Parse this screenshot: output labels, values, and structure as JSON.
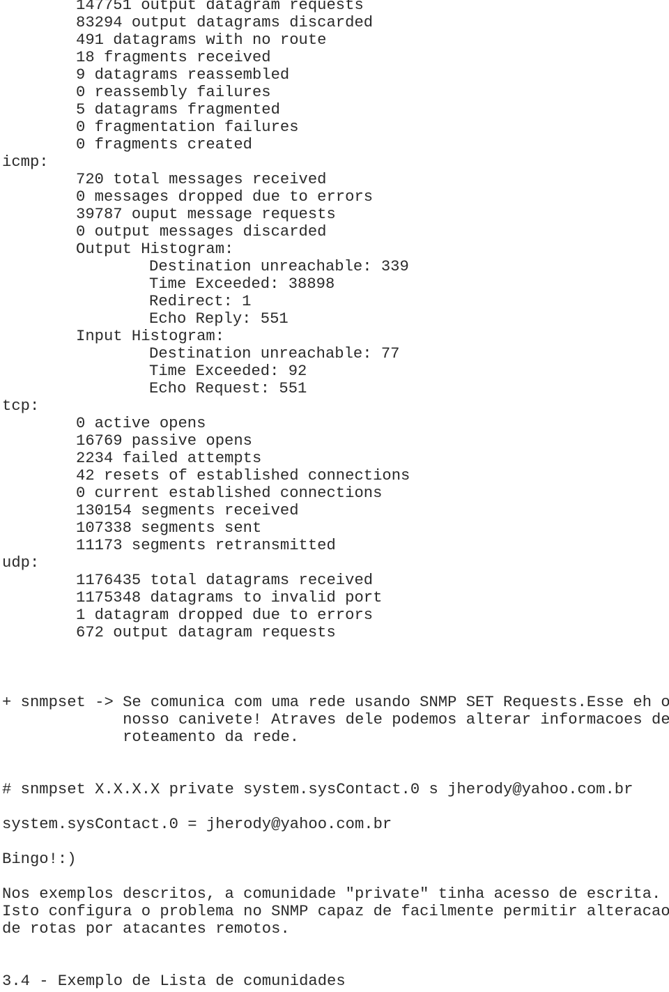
{
  "ip_tail": [
    "147751 output datagram requests",
    "83294 output datagrams discarded",
    "491 datagrams with no route",
    "18 fragments received",
    "9 datagrams reassembled",
    "0 reassembly failures",
    "5 datagrams fragmented",
    "0 fragmentation failures",
    "0 fragments created"
  ],
  "icmp": {
    "label": "icmp:",
    "lines": [
      "720 total messages received",
      "0 messages dropped due to errors",
      "39787 ouput message requests",
      "0 output messages discarded"
    ],
    "output_histogram": {
      "label": "Output Histogram:",
      "items": [
        "Destination unreachable: 339",
        "Time Exceeded: 38898",
        "Redirect: 1",
        "Echo Reply: 551"
      ]
    },
    "input_histogram": {
      "label": "Input Histogram:",
      "items": [
        "Destination unreachable: 77",
        "Time Exceeded: 92",
        "Echo Request: 551"
      ]
    }
  },
  "tcp": {
    "label": "tcp:",
    "lines": [
      "0 active opens",
      "16769 passive opens",
      "2234 failed attempts",
      "42 resets of established connections",
      "0 current established connections",
      "130154 segments received",
      "107338 segments sent",
      "11173 segments retransmitted"
    ]
  },
  "udp": {
    "label": "udp:",
    "lines": [
      "1176435 total datagrams received",
      "1175348 datagrams to invalid port",
      "1 datagram dropped due to errors",
      "672 output datagram requests"
    ]
  },
  "snmpset_note": {
    "lead": "+ snmpset -> ",
    "lines": [
      "Se comunica com uma rede usando SNMP SET Requests.Esse eh o",
      "nosso canivete! Atraves dele podemos alterar informacoes de",
      "roteamento da rede."
    ]
  },
  "command": "# snmpset X.X.X.X private system.sysContact.0 s jherody@yahoo.com.br",
  "command_output": "system.sysContact.0 = jherody@yahoo.com.br",
  "bingo": "Bingo!:)",
  "paragraph": [
    "Nos exemplos descritos, a comunidade \"private\" tinha acesso de escrita.",
    "Isto configura o problema no SNMP capaz de facilmente permitir alteracao",
    "de rotas por atacantes remotos."
  ],
  "section_heading": "3.4 - Exemplo de Lista de comunidades"
}
